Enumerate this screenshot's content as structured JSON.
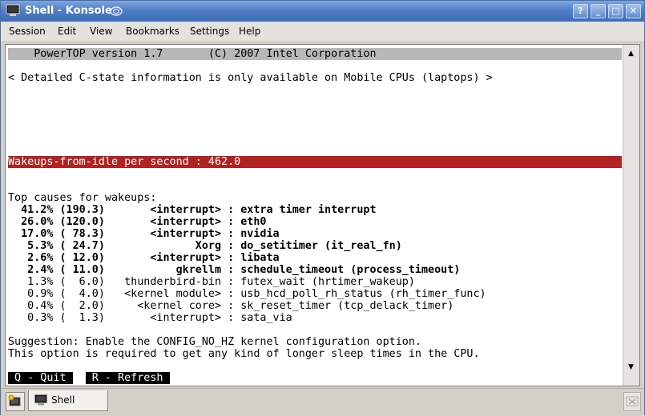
{
  "window": {
    "title": "Shell - Konsole",
    "controls": {
      "help": "?",
      "minimize": "_",
      "maximize": "□",
      "close": "✕"
    }
  },
  "menu": [
    "Session",
    "Edit",
    "View",
    "Bookmarks",
    "Settings",
    "Help"
  ],
  "terminal": {
    "header": "    PowerTOP version 1.7       (C) 2007 Intel Corporation",
    "cstate_note": "< Detailed C-state information is only available on Mobile CPUs (laptops) >",
    "wakeups": "Wakeups-from-idle per second : 462.0",
    "top_causes_title": "Top causes for wakeups:",
    "causes": [
      {
        "text": "  41.2% (190.3)       <interrupt> : extra timer interrupt",
        "bold": true
      },
      {
        "text": "  26.0% (120.0)       <interrupt> : eth0",
        "bold": true
      },
      {
        "text": "  17.0% ( 78.3)       <interrupt> : nvidia",
        "bold": true
      },
      {
        "text": "   5.3% ( 24.7)              Xorg : do_setitimer (it_real_fn)",
        "bold": true
      },
      {
        "text": "   2.6% ( 12.0)       <interrupt> : libata",
        "bold": true
      },
      {
        "text": "   2.4% ( 11.0)           gkrellm : schedule_timeout (process_timeout)",
        "bold": true
      },
      {
        "text": "   1.3% (  6.0)   thunderbird-bin : futex_wait (hrtimer_wakeup)",
        "bold": false
      },
      {
        "text": "   0.9% (  4.0)   <kernel module> : usb_hcd_poll_rh_status (rh_timer_func)",
        "bold": false
      },
      {
        "text": "   0.4% (  2.0)     <kernel core> : sk_reset_timer (tcp_delack_timer)",
        "bold": false
      },
      {
        "text": "   0.3% (  1.3)       <interrupt> : sata_via",
        "bold": false
      }
    ],
    "suggestion_1": "Suggestion: Enable the CONFIG_NO_HZ kernel configuration option.",
    "suggestion_2": "This option is required to get any kind of longer sleep times in the CPU.",
    "key_quit": " Q - Quit ",
    "key_refresh": " R - Refresh "
  },
  "tabs": [
    {
      "label": "Shell"
    }
  ],
  "colors": {
    "wakeups_bar": "#b22222",
    "header_bar": "#b8b8b8",
    "titlebar": "#4f7fc6"
  }
}
